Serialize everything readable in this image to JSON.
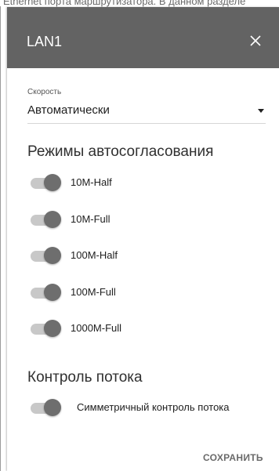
{
  "background": {
    "text": "Ethernet порта маршрутизатора. В данном разделе"
  },
  "dialog": {
    "title": "LAN1",
    "close_icon": "close-icon"
  },
  "speed": {
    "label": "Скорость",
    "value": "Автоматически",
    "dropdown_icon": "caret-down-icon"
  },
  "autoneg": {
    "title": "Режимы автосогласования",
    "modes": [
      {
        "label": "10M-Half",
        "on": true
      },
      {
        "label": "10M-Full",
        "on": true
      },
      {
        "label": "100M-Half",
        "on": true
      },
      {
        "label": "100M-Full",
        "on": true
      },
      {
        "label": "1000M-Full",
        "on": true
      }
    ]
  },
  "flow_control": {
    "title": "Контроль потока",
    "symmetric": {
      "label": "Симметричный контроль потока",
      "on": true
    }
  },
  "footer": {
    "save_label": "СОХРАНИТЬ"
  },
  "colors": {
    "header_bg": "#636363",
    "knob": "#6e6e6e",
    "track": "#c8c8c8"
  }
}
